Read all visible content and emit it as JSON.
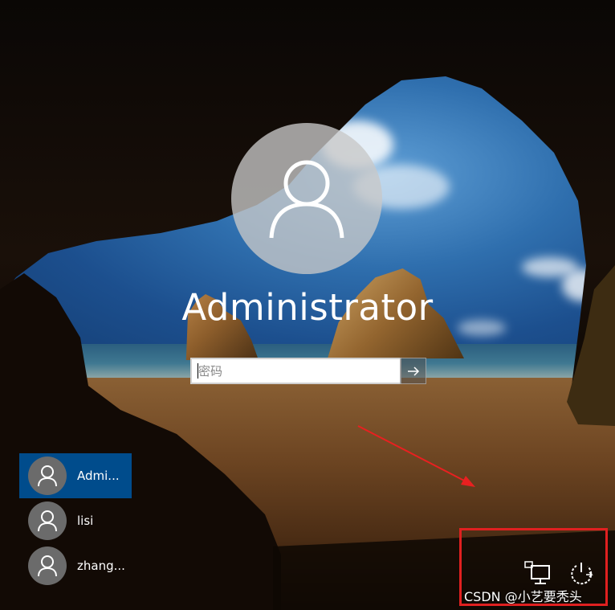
{
  "login": {
    "username": "Administrator",
    "password_placeholder": "密码"
  },
  "user_list": [
    {
      "name": "Admi...",
      "selected": true
    },
    {
      "name": "lisi",
      "selected": false
    },
    {
      "name": "zhang...",
      "selected": false
    }
  ],
  "system_icons": [
    "network-icon",
    "power-icon"
  ],
  "watermark": "CSDN @小艺要秃头",
  "colors": {
    "selected_user_bg": "#004c8c",
    "annotation_red": "#e02020",
    "avatar_gray": "#6b6b6b"
  }
}
